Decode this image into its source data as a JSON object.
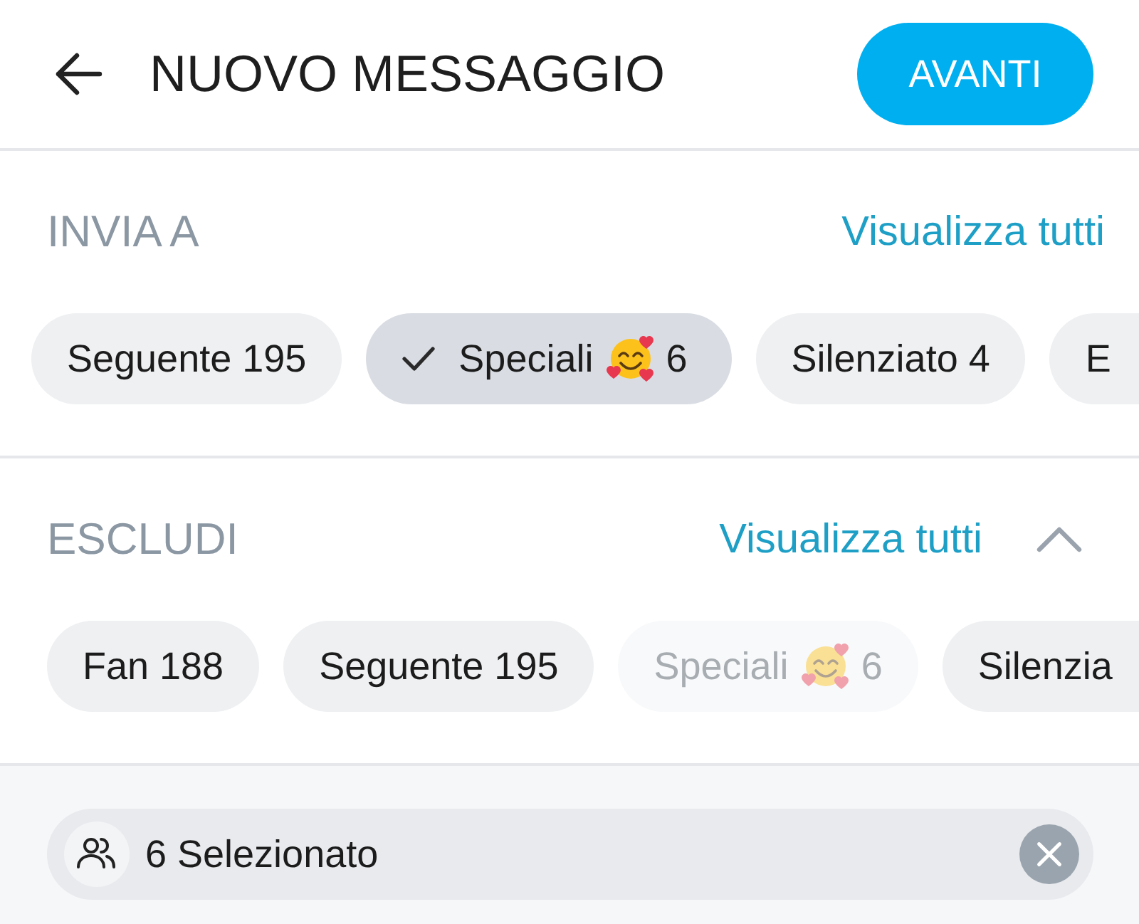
{
  "header": {
    "title": "NUOVO MESSAGGIO",
    "button": "AVANTI"
  },
  "sections": [
    {
      "title": "INVIA A",
      "link": "Visualizza tutti",
      "chips": [
        {
          "kind": "text",
          "label": "Seguente 195",
          "selected": false
        },
        {
          "kind": "emoji",
          "label": "Speciali",
          "count": "6",
          "selected": true
        },
        {
          "kind": "text",
          "label": "Silenziato 4",
          "selected": false
        },
        {
          "kind": "text",
          "label": "E",
          "selected": false,
          "cut": true
        }
      ]
    },
    {
      "title": "ESCLUDI",
      "link": "Visualizza tutti",
      "expanded": true,
      "chips": [
        {
          "kind": "text",
          "label": "Fan 188",
          "selected": false,
          "disabled": false
        },
        {
          "kind": "text",
          "label": "Seguente 195",
          "selected": false,
          "disabled": false
        },
        {
          "kind": "emoji",
          "label": "Speciali",
          "count": "6",
          "selected": false,
          "disabled": true
        },
        {
          "kind": "text",
          "label": "Silenzia",
          "selected": false,
          "disabled": false,
          "cut": true
        }
      ]
    }
  ],
  "selection": {
    "text": "6 Selezionato"
  }
}
